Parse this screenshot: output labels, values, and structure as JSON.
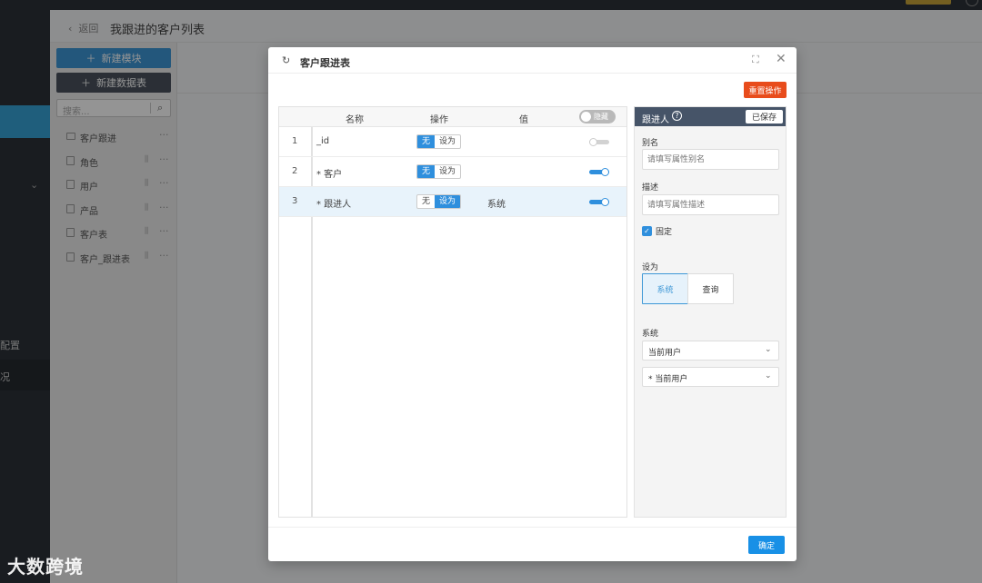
{
  "breadcrumb": {
    "back": "返回",
    "title": "我跟进的客户列表"
  },
  "left_nav": {
    "item_config": "配置",
    "item_overview": "况"
  },
  "sidebar": {
    "new_module": "新建模块",
    "new_table": "新建数据表",
    "search_placeholder": "搜索...",
    "items": [
      {
        "label": "客户跟进",
        "type": "folder"
      },
      {
        "label": "角色",
        "type": "table"
      },
      {
        "label": "用户",
        "type": "table"
      },
      {
        "label": "产品",
        "type": "table"
      },
      {
        "label": "客户表",
        "type": "table"
      },
      {
        "label": "客户_跟进表",
        "type": "table"
      }
    ]
  },
  "watermark": "大数跨境",
  "modal": {
    "title": "客户跟进表",
    "reset_button": "重置操作",
    "confirm_button": "确定",
    "table": {
      "headers": {
        "name": "名称",
        "action": "操作",
        "value": "值",
        "hide_toggle": "隐藏"
      },
      "rows": [
        {
          "index": "1",
          "name": "_id",
          "opt_none": "无",
          "opt_set": "设为",
          "selected_option": "无",
          "value": "",
          "visible": false
        },
        {
          "index": "2",
          "name": "* 客户",
          "opt_none": "无",
          "opt_set": "设为",
          "selected_option": "无",
          "value": "",
          "visible": true
        },
        {
          "index": "3",
          "name": "* 跟进人",
          "opt_none": "无",
          "opt_set": "设为",
          "selected_option": "设为",
          "value": "系统",
          "visible": true
        }
      ]
    },
    "properties": {
      "title": "跟进人",
      "help_icon": "?",
      "saved_button": "已保存",
      "alias_label": "别名",
      "alias_placeholder": "请填写属性别名",
      "desc_label": "描述",
      "desc_placeholder": "请填写属性描述",
      "fixed_label": "固定",
      "fixed_checked": true,
      "set_as_label": "设为",
      "set_as_options": [
        "系统",
        "查询"
      ],
      "set_as_selected": "系统",
      "system_label": "系统",
      "system_select_1": "当前用户",
      "system_select_2": "* 当前用户"
    }
  },
  "colors": {
    "primary": "#1890e6",
    "danger": "#e84c1c",
    "panel_header": "#465468",
    "nav_active": "#36a3d6"
  }
}
